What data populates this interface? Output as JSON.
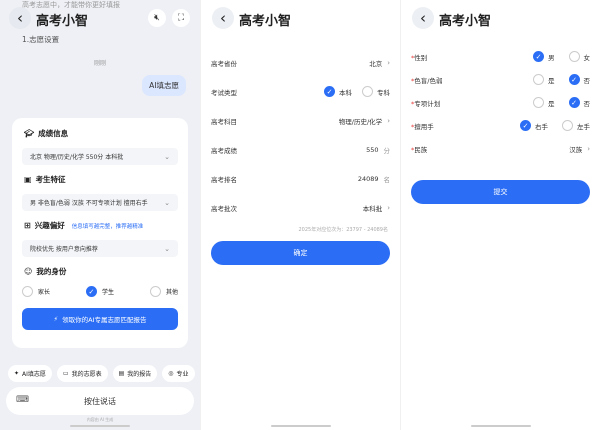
{
  "p1": {
    "faded_top": "高考志愿中，才能带你更好填报",
    "title": "高考小智",
    "subtitle": "1.志愿设置",
    "time": "刚刚",
    "user_msg": "AI填志愿",
    "sections": {
      "scores": {
        "label": "成绩信息",
        "value": "北京 物理/历史/化学 550分 本科批"
      },
      "traits": {
        "label": "考生特征",
        "value": "男 非色盲/色弱 汉族 不可专项计划 擅用右手"
      },
      "interest": {
        "label": "兴趣偏好",
        "hint": "信息填写越完整，推荐越精准",
        "value": "院校优先 按用户意向推荐"
      },
      "identity": {
        "label": "我的身份",
        "options": [
          "家长",
          "学生",
          "其他"
        ],
        "selected": 1
      }
    },
    "cta": "领取你的AI专属志愿匹配报告",
    "chips": [
      {
        "icon": "sparkle",
        "label": "AI填志愿"
      },
      {
        "icon": "folder",
        "label": "我的志愿表"
      },
      {
        "icon": "report",
        "label": "我的报告"
      },
      {
        "icon": "target",
        "label": "专业"
      }
    ],
    "voice": "按住说话",
    "ai_note": "内容由 AI 生成"
  },
  "p2": {
    "title": "高考小智",
    "rows": [
      {
        "label": "高考省份",
        "value": "北京"
      },
      {
        "label": "考试类型",
        "options": [
          "本科",
          "专科"
        ],
        "selected": 0
      },
      {
        "label": "高考科目",
        "value": "物理/历史/化学"
      },
      {
        "label": "高考成绩",
        "value": "550",
        "unit": "分"
      },
      {
        "label": "高考排名",
        "value": "24089",
        "unit": "名"
      },
      {
        "label": "高考批次",
        "value": "本科批"
      }
    ],
    "note": "2025年对应位次为：23797 - 24089名",
    "confirm": "确定"
  },
  "p3": {
    "title": "高考小智",
    "rows": [
      {
        "label": "性别",
        "required": true,
        "options": [
          "男",
          "女"
        ],
        "selected": 0
      },
      {
        "label": "色盲/色弱",
        "required": true,
        "options": [
          "是",
          "否"
        ],
        "selected": 1
      },
      {
        "label": "专项计划",
        "required": true,
        "options": [
          "是",
          "否"
        ],
        "selected": 1
      },
      {
        "label": "擅用手",
        "required": true,
        "options": [
          "右手",
          "左手"
        ],
        "selected": 0
      },
      {
        "label": "民族",
        "required": true,
        "value": "汉族"
      }
    ],
    "submit": "提交"
  },
  "colors": {
    "accent": "#2b6ef5",
    "required": "#e53935"
  }
}
